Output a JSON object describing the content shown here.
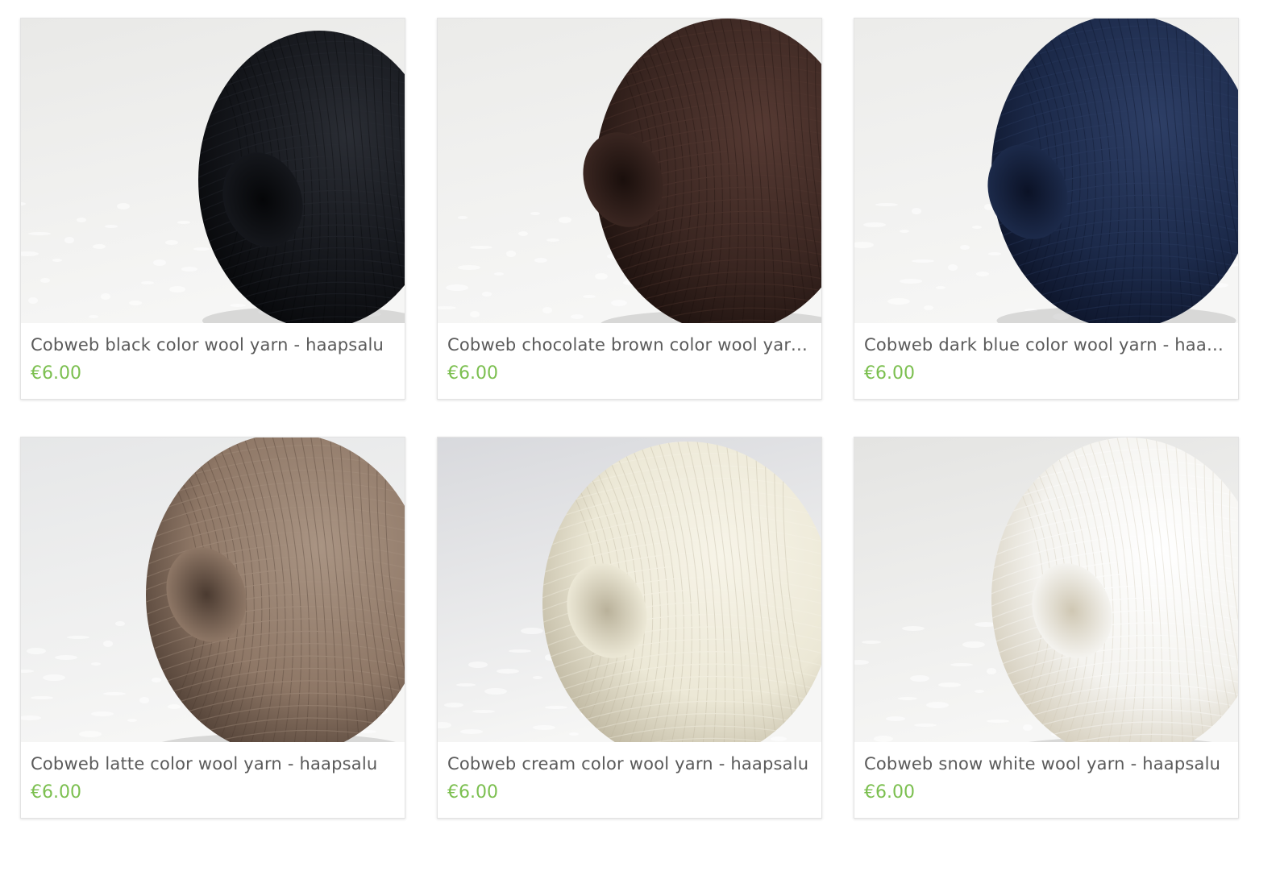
{
  "products": [
    {
      "title": "Cobweb black color wool yarn - haapsalu",
      "price": "€6.00",
      "yarn_color": "#15171c",
      "yarn_shadow": "#050608",
      "yarn_highlight": "#2a2d34",
      "background": "#e9e9e7"
    },
    {
      "title": "Cobweb chocolate brown color wool yarn - haapsalu",
      "price": "€6.00",
      "yarn_color": "#3a2621",
      "yarn_shadow": "#1a0f0c",
      "yarn_highlight": "#563a33",
      "background": "#ebebe9"
    },
    {
      "title": "Cobweb dark blue color wool yarn - haapsalu",
      "price": "€6.00",
      "yarn_color": "#1c2a4a",
      "yarn_shadow": "#0b1226",
      "yarn_highlight": "#2e3f66",
      "background": "#ececea"
    },
    {
      "title": "Cobweb latte color wool yarn - haapsalu",
      "price": "€6.00",
      "yarn_color": "#8e7766",
      "yarn_shadow": "#4a3a30",
      "yarn_highlight": "#a99483",
      "background": "#e6e7e8"
    },
    {
      "title": "Cobweb cream color wool yarn - haapsalu",
      "price": "€6.00",
      "yarn_color": "#ece8d6",
      "yarn_shadow": "#b9b19a",
      "yarn_highlight": "#f7f4e8",
      "background": "#d8d9dd"
    },
    {
      "title": "Cobweb snow white wool yarn - haapsalu",
      "price": "€6.00",
      "yarn_color": "#f4f3ef",
      "yarn_shadow": "#cfc7b3",
      "yarn_highlight": "#ffffff",
      "background": "#e4e4e2"
    }
  ],
  "colors": {
    "price": "#7bbf4f",
    "title": "#5a5a5a"
  }
}
